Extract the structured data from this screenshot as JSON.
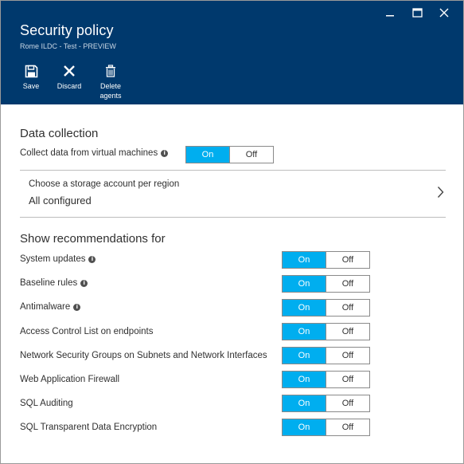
{
  "window": {
    "controls": [
      {
        "name": "minimize-icon"
      },
      {
        "name": "maximize-icon"
      },
      {
        "name": "close-icon"
      }
    ]
  },
  "header": {
    "title": "Security policy",
    "subtitle": "Rome ILDC - Test - PREVIEW",
    "background": "#00396d"
  },
  "toolbar": {
    "save_label": "Save",
    "discard_label": "Discard",
    "delete_label": "Delete agents"
  },
  "data_collection": {
    "title": "Data collection",
    "collect_label": "Collect data from virtual machines",
    "collect_state": "On",
    "on_label": "On",
    "off_label": "Off"
  },
  "storage": {
    "label": "Choose a storage account per region",
    "value": "All configured"
  },
  "recommendations": {
    "title": "Show recommendations for",
    "on_label": "On",
    "off_label": "Off",
    "items": [
      {
        "label": "System updates",
        "info": true,
        "state": "On"
      },
      {
        "label": "Baseline rules",
        "info": true,
        "state": "On"
      },
      {
        "label": "Antimalware",
        "info": true,
        "state": "On"
      },
      {
        "label": "Access Control List on endpoints",
        "info": false,
        "state": "On"
      },
      {
        "label": "Network Security Groups on Subnets and Network Interfaces",
        "info": false,
        "state": "On"
      },
      {
        "label": "Web Application Firewall",
        "info": false,
        "state": "On"
      },
      {
        "label": "SQL Auditing",
        "info": false,
        "state": "On"
      },
      {
        "label": "SQL Transparent Data Encryption",
        "info": false,
        "state": "On"
      }
    ]
  },
  "colors": {
    "accent_on": "#00aeef",
    "header_bg": "#00396d"
  }
}
